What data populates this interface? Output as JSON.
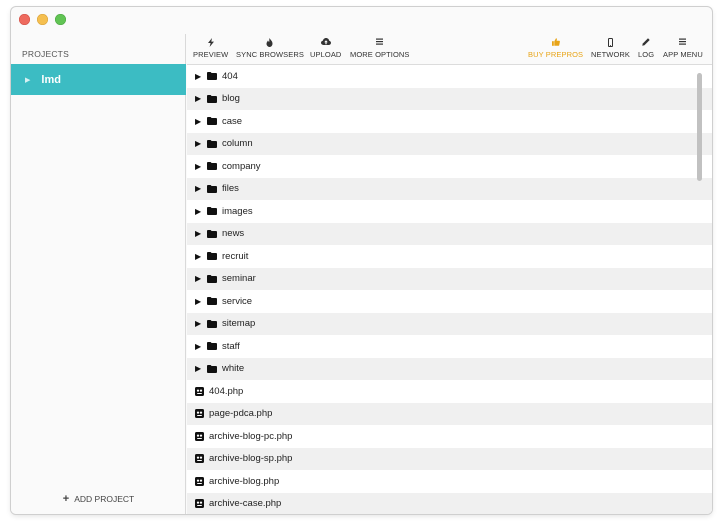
{
  "sidebar": {
    "header": "PROJECTS",
    "projects": [
      {
        "name": "lmd"
      }
    ],
    "add_project": "ADD PROJECT"
  },
  "toolbar": {
    "preview": "PREVIEW",
    "sync_browsers": "SYNC BROWSERS",
    "upload": "UPLOAD",
    "more_options": "MORE OPTIONS",
    "buy_prepros": "BUY PREPROS",
    "network": "NETWORK",
    "log": "LOG",
    "app_menu": "APP MENU"
  },
  "files": {
    "folders": [
      "404",
      "blog",
      "case",
      "column",
      "company",
      "files",
      "images",
      "news",
      "recruit",
      "seminar",
      "service",
      "sitemap",
      "staff",
      "white"
    ],
    "items": [
      "404.php",
      "page-pdca.php",
      "archive-blog-pc.php",
      "archive-blog-sp.php",
      "archive-blog.php",
      "archive-case.php"
    ]
  },
  "colors": {
    "accent": "#3cbcc3",
    "buy": "#e8a417"
  }
}
